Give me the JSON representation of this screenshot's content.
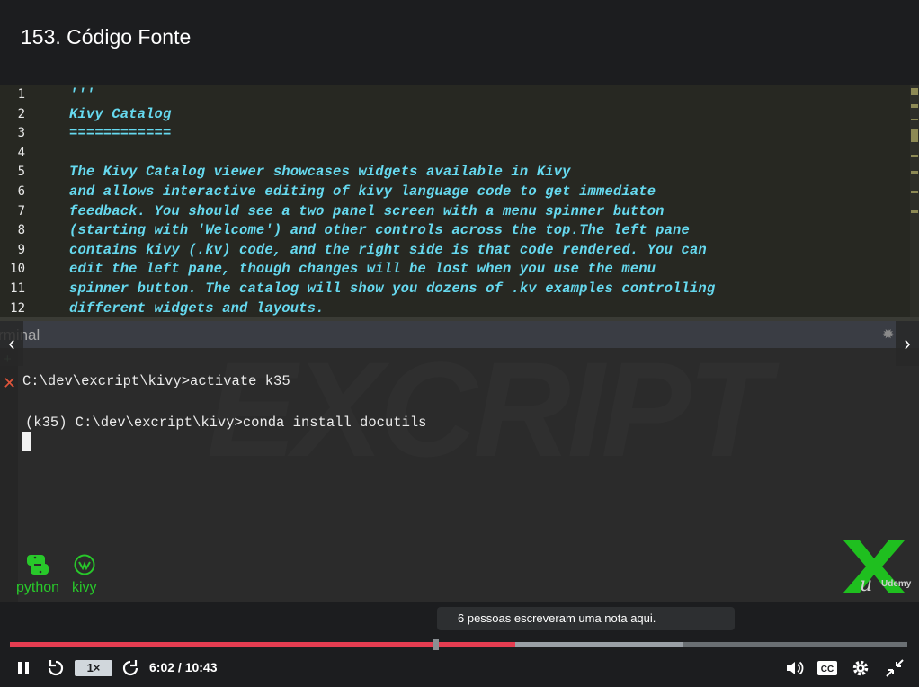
{
  "header": {
    "title": "153. Código Fonte"
  },
  "editor": {
    "line_numbers": [
      "1",
      "2",
      "3",
      "4",
      "5",
      "6",
      "7",
      "8",
      "9",
      "10",
      "11",
      "12"
    ],
    "lines": [
      "'''",
      "Kivy Catalog",
      "============",
      "",
      "The Kivy Catalog viewer showcases widgets available in Kivy",
      "and allows interactive editing of kivy language code to get immediate",
      "feedback. You should see a two panel screen with a menu spinner button",
      "(starting with 'Welcome') and other controls across the top.The left pane",
      "contains kivy (.kv) code, and the right side is that code rendered. You can",
      "edit the left pane, though changes will be lost when you use the menu",
      "spinner button. The catalog will show you dozens of .kv examples controlling",
      "different widgets and layouts."
    ]
  },
  "terminal": {
    "title": "rminal",
    "lines": [
      "C:\\dev\\excript\\kivy>activate k35",
      "(k35) C:\\dev\\excript\\kivy>conda install docutils"
    ]
  },
  "watermark": {
    "text": "EXCRIPT"
  },
  "logos": {
    "python": "python",
    "kivy": "kivy",
    "brand": "Udemy"
  },
  "player": {
    "note_text": "6 pessoas escreveram uma nota aqui.",
    "speed_label": "1×",
    "time_label": "6:02 / 10:43",
    "played_fraction": 0.563,
    "buffered_fraction": 0.75,
    "marker_fraction": 0.475
  },
  "colors": {
    "accent": "#e53d51",
    "code": "#66d9ef",
    "logo_green": "#28c82a"
  }
}
